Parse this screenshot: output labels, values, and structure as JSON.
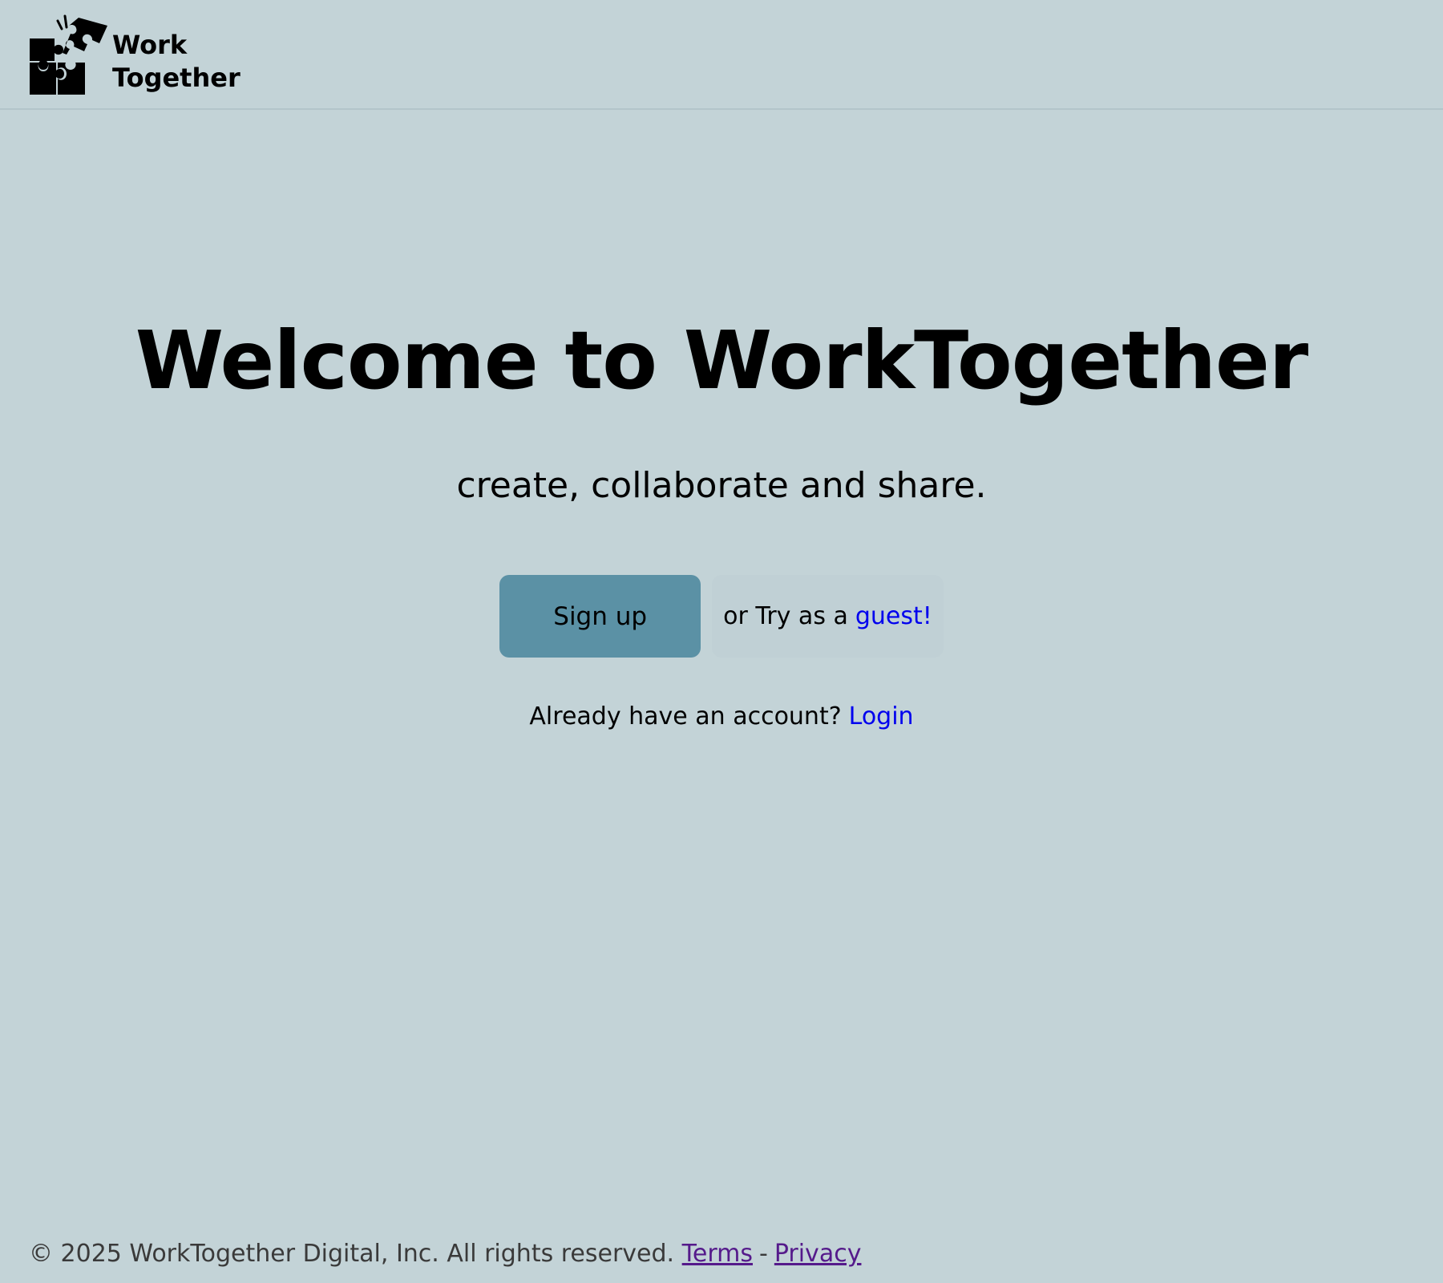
{
  "header": {
    "logo": {
      "icon": "puzzle-pieces-icon",
      "line1": "Work",
      "line2": "Together"
    }
  },
  "hero": {
    "title": "Welcome to WorkTogether",
    "subtitle": "create, collaborate and share."
  },
  "cta": {
    "signup_label": "Sign up",
    "guest_prefix": "or Try as a",
    "guest_link": "guest!"
  },
  "login": {
    "prefix": "Already have an account?",
    "link": "Login"
  },
  "footer": {
    "copyright": "© 2025 WorkTogether Digital, Inc. All rights reserved.",
    "terms": "Terms",
    "separator": "-",
    "privacy": "Privacy"
  },
  "colors": {
    "background": "#c3d3d7",
    "button": "#5b91a5",
    "link": "#0000ee",
    "visited_link": "#551a8b"
  }
}
